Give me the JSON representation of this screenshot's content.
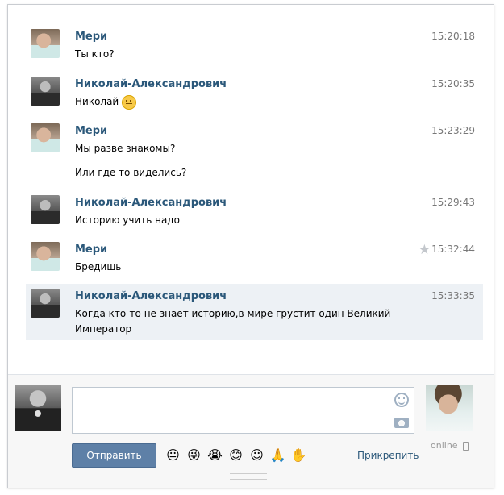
{
  "messages": [
    {
      "author": "Мери",
      "time": "15:20:18",
      "lines": [
        "Ты кто?"
      ]
    },
    {
      "author": "Николай-Александрович",
      "time": "15:20:35",
      "lines": [
        "Николай"
      ],
      "emoji": "neutral-face"
    },
    {
      "author": "Мери",
      "time": "15:23:29",
      "lines": [
        "Мы разве знакомы?",
        "Или где то виделись?"
      ]
    },
    {
      "author": "Николай-Александрович",
      "time": "15:29:43",
      "lines": [
        "Историю учить надо"
      ]
    },
    {
      "author": "Мери",
      "time": "15:32:44",
      "lines": [
        "Бредишь"
      ],
      "starred": true
    },
    {
      "author": "Николай-Александрович",
      "time": "15:33:35",
      "lines": [
        "Когда кто-то не знает историю,в мире грустит один Великий",
        "Император"
      ],
      "highlighted": true
    }
  ],
  "composer": {
    "message_value": "",
    "send_label": "Отправить",
    "attach_label": "Прикрепить",
    "interlocutor_status": "online",
    "quick_emoji": [
      "😐",
      "😜",
      "😭",
      "😊",
      "☺",
      "🙏",
      "✋"
    ]
  },
  "colors": {
    "author": "#2b587a",
    "send_button": "#5e80a7",
    "highlight": "#edf1f5"
  },
  "icons": [
    "smile-icon",
    "camera-icon",
    "star-icon",
    "mobile-phone-icon"
  ]
}
